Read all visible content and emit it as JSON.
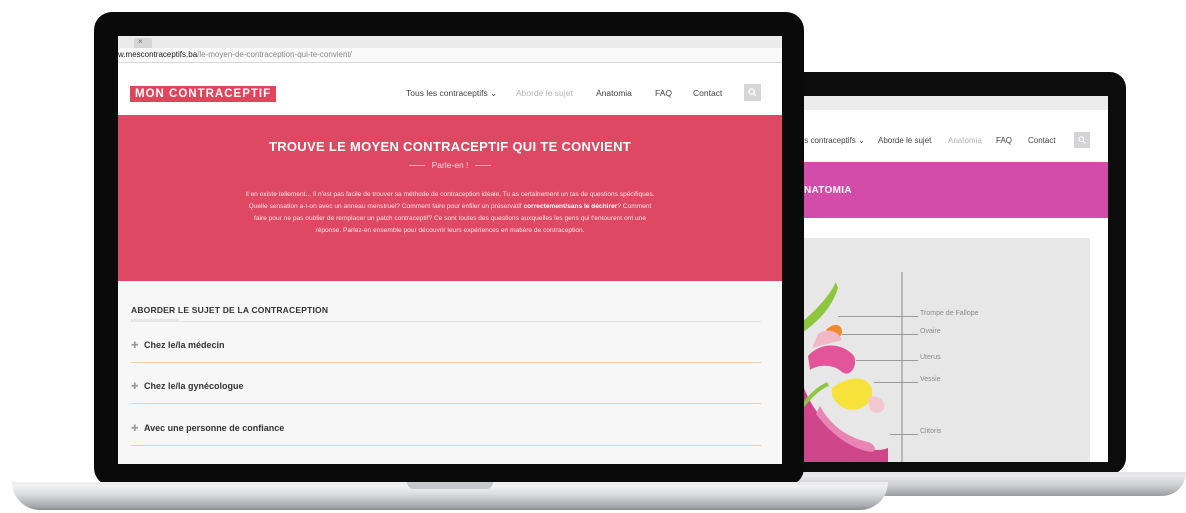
{
  "front": {
    "tab_close": "×",
    "url": {
      "host": "w.mescontraceptifs.ba",
      "path": "/le-moyen-de-contraception-qui-te-convient/"
    },
    "logo_text": "MON CONTRACEPTIF",
    "nav": [
      {
        "label": "Tous les contraceptifs ⌄",
        "state": "normal"
      },
      {
        "label": "Aborde le sujet",
        "state": "active-muted"
      },
      {
        "label": "Anatomia",
        "state": "normal"
      },
      {
        "label": "FAQ",
        "state": "normal"
      },
      {
        "label": "Contact",
        "state": "normal"
      }
    ],
    "hero": {
      "title": "TROUVE LE MOYEN CONTRACEPTIF QUI TE CONVIENT",
      "subtitle": "Parle-en !",
      "body_1": "Il en existe tellement... Il n'est pas facile de trouver sa méthode de contraception idéale. Tu as certainement un tas de questions spécifiques. Quelle sensation a-t-on avec un anneau menstruel? Comment faire pour enfiler un préservatif",
      "body_bold": "correctement/sans le déchirer",
      "body_2": "? Comment faire pour ne pas oublier de remplacer un patch contraceptif? Ce sont toutes des questions auxquelles les gens qui t'entourent ont une réponse. Parlez-en ensemble pour découvrir leurs expériences en matière de contraception.",
      "color": "#df4862"
    },
    "section_title": "ABORDER LE SUJET DE LA CONTRACEPTION",
    "accordion": [
      {
        "label": "Chez le/la médecin"
      },
      {
        "label": "Chez le/la gynécologue"
      },
      {
        "label": "Avec une personne de confiance"
      }
    ]
  },
  "back": {
    "nav": [
      {
        "label": "les contraceptifs ⌄",
        "state": "normal"
      },
      {
        "label": "Aborde le sujet",
        "state": "normal"
      },
      {
        "label": "Anatomia",
        "state": "active-muted"
      },
      {
        "label": "FAQ",
        "state": "normal"
      },
      {
        "label": "Contact",
        "state": "normal"
      }
    ],
    "hero_title": "NATOMIA",
    "hero_color": "#d34ca9",
    "anatomy_labels": [
      {
        "label": "Trompe de Fallope"
      },
      {
        "label": "Ovaire"
      },
      {
        "label": "Uterus"
      },
      {
        "label": "Vessie"
      },
      {
        "label": "Clitoris"
      }
    ]
  },
  "icons": {
    "search": "search-icon",
    "plus": "plus-icon"
  }
}
